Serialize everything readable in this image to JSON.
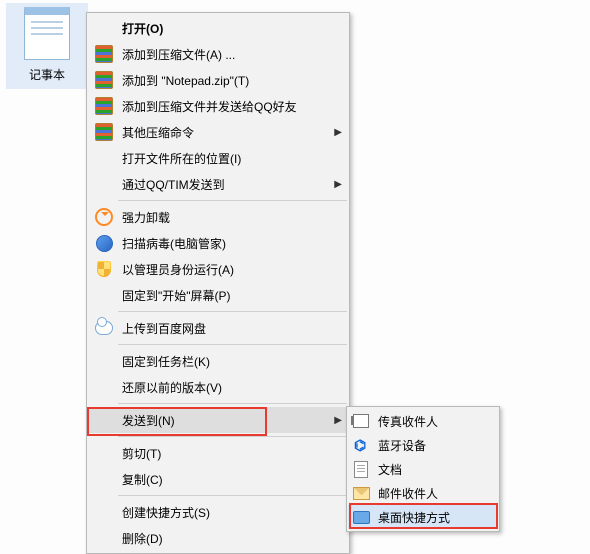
{
  "desktop": {
    "app_label": "记事本"
  },
  "menu": {
    "open": "打开(O)",
    "add_archive": "添加到压缩文件(A) ...",
    "add_notepad_zip": "添加到 \"Notepad.zip\"(T)",
    "add_send_qq": "添加到压缩文件并发送给QQ好友",
    "other_compress": "其他压缩命令",
    "open_location": "打开文件所在的位置(I)",
    "send_qq_tim": "通过QQ/TIM发送到",
    "force_uninstall": "强力卸载",
    "scan_virus": "扫描病毒(电脑管家)",
    "run_admin": "以管理员身份运行(A)",
    "pin_start": "固定到\"开始\"屏幕(P)",
    "upload_baidu": "上传到百度网盘",
    "pin_taskbar": "固定到任务栏(K)",
    "restore_prev": "还原以前的版本(V)",
    "send_to": "发送到(N)",
    "cut": "剪切(T)",
    "copy": "复制(C)",
    "create_shortcut": "创建快捷方式(S)",
    "delete": "删除(D)"
  },
  "submenu": {
    "fax": "传真收件人",
    "bluetooth": "蓝牙设备",
    "docs": "文档",
    "mail": "邮件收件人",
    "desktop_shortcut": "桌面快捷方式"
  }
}
